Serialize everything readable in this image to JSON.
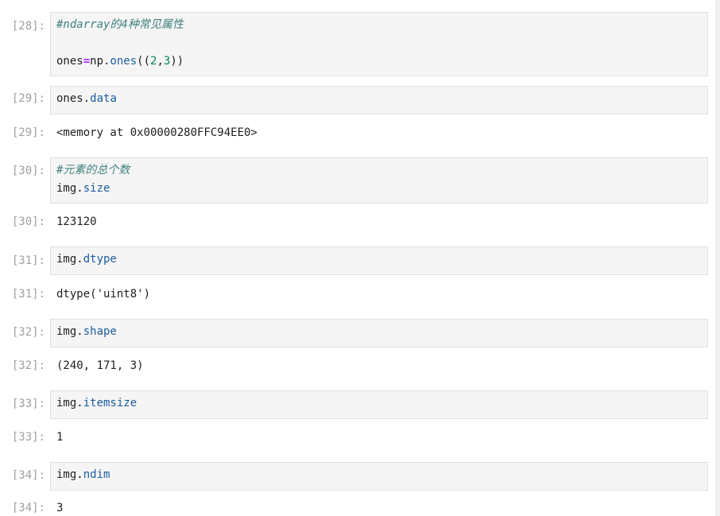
{
  "cells": [
    {
      "in_prompt": "[28]:",
      "comment": "#ndarray的4种常见属性",
      "code_var": "ones",
      "code_op": "=",
      "code_mod": "np.",
      "code_fn": "ones",
      "code_open": "((",
      "code_n1": "2",
      "code_sep": ",",
      "code_n2": "3",
      "code_close": "))"
    },
    {
      "in_prompt": "[29]:",
      "code_obj": "ones.",
      "code_attr": "data",
      "out_prompt": "[29]:",
      "output": "<memory at 0x00000280FFC94EE0>"
    },
    {
      "in_prompt": "[30]:",
      "comment": "#元素的总个数",
      "code_obj": "img.",
      "code_attr": "size",
      "out_prompt": "[30]:",
      "output": "123120"
    },
    {
      "in_prompt": "[31]:",
      "code_obj": "img.",
      "code_attr": "dtype",
      "out_prompt": "[31]:",
      "output": "dtype('uint8')"
    },
    {
      "in_prompt": "[32]:",
      "code_obj": "img.",
      "code_attr": "shape",
      "out_prompt": "[32]:",
      "output": "(240, 171, 3)"
    },
    {
      "in_prompt": "[33]:",
      "code_obj": "img.",
      "code_attr": "itemsize",
      "out_prompt": "[33]:",
      "output": "1"
    },
    {
      "in_prompt": "[34]:",
      "code_obj": "img.",
      "code_attr": "ndim",
      "out_prompt": "[34]:",
      "output": "3"
    }
  ]
}
